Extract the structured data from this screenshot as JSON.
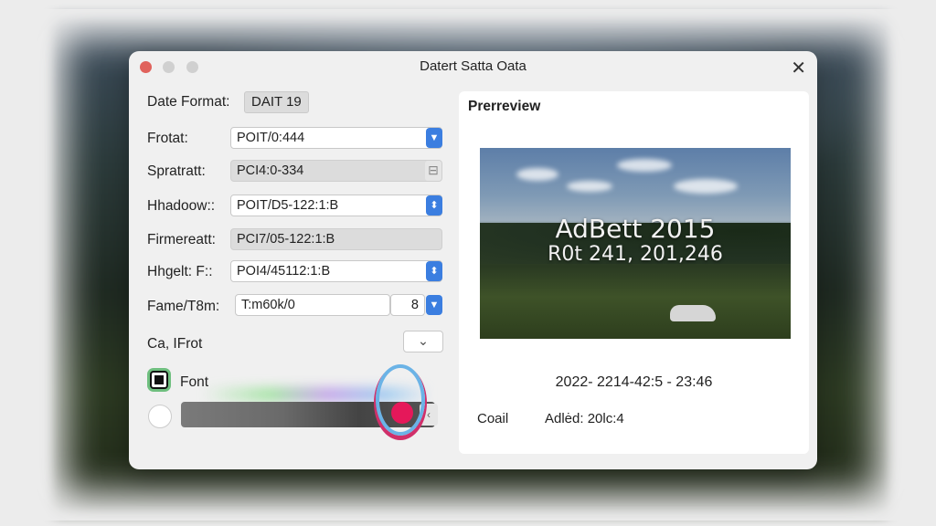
{
  "window": {
    "title": "Datert Satta Oata"
  },
  "form": {
    "date_format": {
      "label": "Date Format:",
      "value": "DAIT 19"
    },
    "rows": [
      {
        "label": "Frotat:",
        "value": "POIT/0:444"
      },
      {
        "label": "Spratratt:",
        "value": "PCI4:0-334"
      },
      {
        "label": "Hhadoow::",
        "value": "POIT/D5-122:1:B"
      },
      {
        "label": "Firmereatt:",
        "value": "PCI7/05-122:1:B"
      },
      {
        "label": "Hhgelt: F::",
        "value": "POI4/45112:1:B"
      },
      {
        "label": "Fame/T8m:",
        "value": "T:m60k/0",
        "suffix": "8"
      }
    ],
    "ca_label": "Ca, IFrot",
    "font_checkbox_label": "Font"
  },
  "preview": {
    "title": "Prerreview",
    "overlay_line1": "AdBett 2015",
    "overlay_line2": "R0t 241, 201,246",
    "timestamp": "2022- 2214-42:5 - 23:46",
    "left_text": "Coail",
    "right_text": "Adlėd: 20lc:4"
  },
  "icons": {
    "dropdown": "chevron-down",
    "stepper": "chevron-up-down",
    "close": "close-x"
  }
}
